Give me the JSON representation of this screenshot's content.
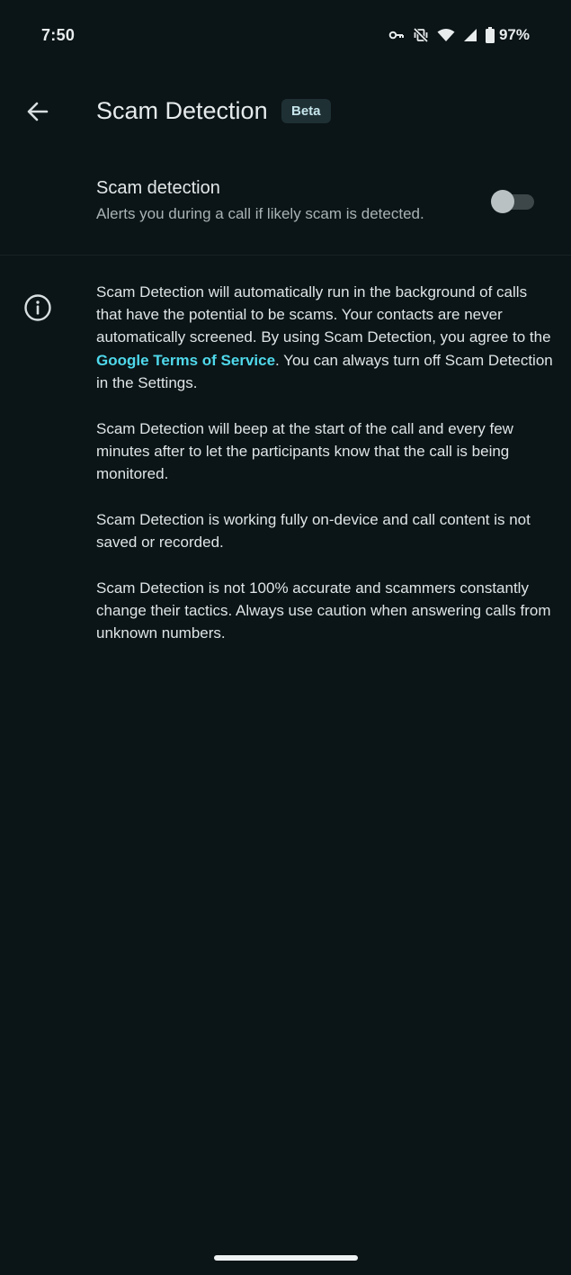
{
  "status_bar": {
    "time": "7:50",
    "battery": "97%",
    "icons": [
      "vpn-key-icon",
      "vibrate-off-icon",
      "wifi-icon",
      "signal-icon",
      "battery-icon"
    ]
  },
  "header": {
    "back_icon": "arrow-back-icon",
    "title": "Scam Detection",
    "badge": "Beta"
  },
  "setting": {
    "title": "Scam detection",
    "subtitle": "Alerts you during a call if likely scam is detected.",
    "enabled": false
  },
  "info": {
    "icon": "info-icon",
    "p1_before": "Scam Detection will automatically run in the background of calls that have the potential to be scams. Your contacts are never automatically screened. By using Scam Detection, you agree to the ",
    "p1_link": "Google Terms of Service",
    "p1_after": ". You can always turn off Scam Detection in the Settings.",
    "p2": "Scam Detection will beep at the start of the call and every few minutes after to let the participants know that the call is being monitored.",
    "p3": "Scam Detection is working fully on-device and call content is not saved or recorded.",
    "p4": "Scam Detection is not 100% accurate and scammers constantly change their tactics. Always use caution when answering calls from unknown numbers."
  },
  "colors": {
    "background": "#0b1416",
    "link": "#4fd8eb",
    "badge_bg": "#1f3034"
  }
}
